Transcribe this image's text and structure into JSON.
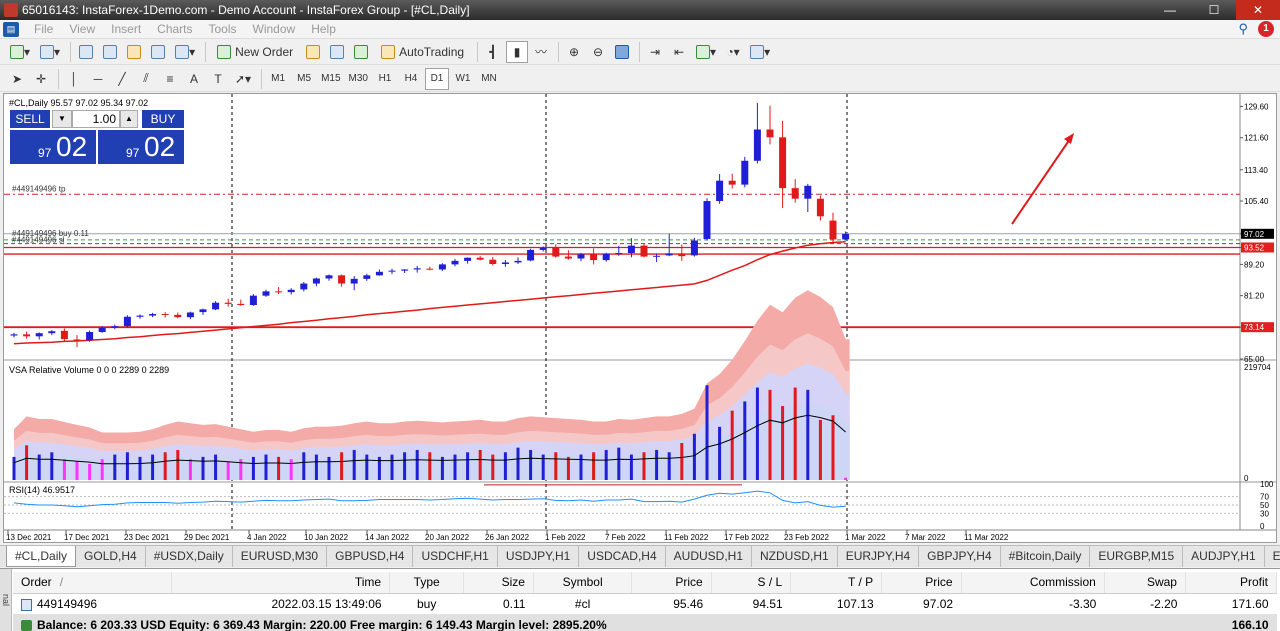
{
  "window": {
    "title": "65016143: InstaForex-1Demo.com - Demo Account - InstaForex Group - [#CL,Daily]",
    "min": "—",
    "max": "☐",
    "close": "✕"
  },
  "menu": {
    "items": [
      "File",
      "View",
      "Insert",
      "Charts",
      "Tools",
      "Window",
      "Help"
    ],
    "notification_count": "1"
  },
  "toolbar": {
    "new_order": "New Order",
    "autotrading": "AutoTrading",
    "timeframes": [
      "M1",
      "M5",
      "M15",
      "M30",
      "H1",
      "H4",
      "D1",
      "W1",
      "MN"
    ],
    "active_timeframe": "D1",
    "text_tool": "A"
  },
  "chart": {
    "header": "#CL,Daily  95.57 97.02 95.34 97.02",
    "vsa_label": "VSA Relative Volume 0 0 0 2289 0 2289",
    "rsi_label": "RSI(14) 46.9517",
    "order_labels": {
      "tp": "#449149496 tp",
      "buy": "#449149496 buy 0.11",
      "sl": "#449149496 sl"
    },
    "trade_panel": {
      "sell": "SELL",
      "buy": "BUY",
      "lot": "1.00",
      "sell_price_small": "97",
      "sell_price_big": "02",
      "buy_price_small": "97",
      "buy_price_big": "02"
    },
    "price_axis": [
      "129.60",
      "121.60",
      "113.40",
      "105.40",
      "97.02",
      "93.52",
      "89.20",
      "81.20",
      "73.14",
      "65.00"
    ],
    "price_badges": [
      {
        "text": "97.02",
        "color": "#000000"
      },
      {
        "text": "93.52",
        "color": "#e02020"
      },
      {
        "text": "73.14",
        "color": "#e02020"
      }
    ],
    "volume_axis": [
      "219704",
      "0"
    ],
    "rsi_axis": [
      "100",
      "70",
      "50",
      "30",
      "0"
    ],
    "date_axis": [
      "13 Dec 2021",
      "17 Dec 2021",
      "23 Dec 2021",
      "29 Dec 2021",
      "4 Jan 2022",
      "10 Jan 2022",
      "14 Jan 2022",
      "20 Jan 2022",
      "26 Jan 2022",
      "1 Feb 2022",
      "7 Feb 2022",
      "11 Feb 2022",
      "17 Feb 2022",
      "23 Feb 2022",
      "1 Mar 2022",
      "7 Mar 2022",
      "11 Mar 2022"
    ]
  },
  "chart_data": {
    "type": "candlestick",
    "symbol": "#CL",
    "timeframe": "Daily",
    "ylim": [
      65.0,
      131.5
    ],
    "candles": [
      [
        71.0,
        71.7,
        70.5,
        71.3
      ],
      [
        71.3,
        72.0,
        70.2,
        70.8
      ],
      [
        70.8,
        71.8,
        70.0,
        71.6
      ],
      [
        71.6,
        72.4,
        71.1,
        72.1
      ],
      [
        72.2,
        72.8,
        69.6,
        70.1
      ],
      [
        70.0,
        71.1,
        68.0,
        69.8
      ],
      [
        69.8,
        72.3,
        69.4,
        71.9
      ],
      [
        71.9,
        73.4,
        71.7,
        73.0
      ],
      [
        73.0,
        73.8,
        72.6,
        73.4
      ],
      [
        73.4,
        76.2,
        73.1,
        75.8
      ],
      [
        75.8,
        76.4,
        75.3,
        76.1
      ],
      [
        76.1,
        76.8,
        75.7,
        76.5
      ],
      [
        76.5,
        77.0,
        75.6,
        76.3
      ],
      [
        76.3,
        76.9,
        75.4,
        75.7
      ],
      [
        75.7,
        77.1,
        75.2,
        76.9
      ],
      [
        77.0,
        77.9,
        76.3,
        77.7
      ],
      [
        77.7,
        79.8,
        77.5,
        79.4
      ],
      [
        79.4,
        80.4,
        78.4,
        79.1
      ],
      [
        79.1,
        80.2,
        78.6,
        78.8
      ],
      [
        78.8,
        81.6,
        78.6,
        81.2
      ],
      [
        81.2,
        82.7,
        80.9,
        82.3
      ],
      [
        82.3,
        83.4,
        81.6,
        82.1
      ],
      [
        82.1,
        83.1,
        81.5,
        82.7
      ],
      [
        82.8,
        84.7,
        82.3,
        84.3
      ],
      [
        84.3,
        85.8,
        83.6,
        85.6
      ],
      [
        85.6,
        86.6,
        85.0,
        86.4
      ],
      [
        86.4,
        86.6,
        83.5,
        84.3
      ],
      [
        84.3,
        86.2,
        82.6,
        85.5
      ],
      [
        85.5,
        86.8,
        85.0,
        86.4
      ],
      [
        86.4,
        87.9,
        86.3,
        87.3
      ],
      [
        87.4,
        88.1,
        86.7,
        87.6
      ],
      [
        87.6,
        88.0,
        87.0,
        87.9
      ],
      [
        87.9,
        88.8,
        87.1,
        88.2
      ],
      [
        88.1,
        88.6,
        87.7,
        87.9
      ],
      [
        87.9,
        89.5,
        87.5,
        89.2
      ],
      [
        89.2,
        90.6,
        88.7,
        90.1
      ],
      [
        90.1,
        91.0,
        89.4,
        90.9
      ],
      [
        90.9,
        91.3,
        90.2,
        90.4
      ],
      [
        90.4,
        91.1,
        88.9,
        89.3
      ],
      [
        89.3,
        90.3,
        88.6,
        89.7
      ],
      [
        89.7,
        91.0,
        89.3,
        90.1
      ],
      [
        90.2,
        93.2,
        90.0,
        92.9
      ],
      [
        92.9,
        93.8,
        92.5,
        93.4
      ],
      [
        93.4,
        94.3,
        90.9,
        91.2
      ],
      [
        91.2,
        92.8,
        90.4,
        90.7
      ],
      [
        90.7,
        92.1,
        90.0,
        91.8
      ],
      [
        91.8,
        93.3,
        89.2,
        90.3
      ],
      [
        90.3,
        92.2,
        89.9,
        91.9
      ],
      [
        91.9,
        93.9,
        91.4,
        92.1
      ],
      [
        92.1,
        95.9,
        91.0,
        94.0
      ],
      [
        94.0,
        94.6,
        91.0,
        91.2
      ],
      [
        91.2,
        92.0,
        89.8,
        91.4
      ],
      [
        91.5,
        97.0,
        91.3,
        92.0
      ],
      [
        92.0,
        94.3,
        90.1,
        91.3
      ],
      [
        91.5,
        96.0,
        91.2,
        95.3
      ],
      [
        95.7,
        106.1,
        95.3,
        105.4
      ],
      [
        105.4,
        112.3,
        104.7,
        110.6
      ],
      [
        110.6,
        112.4,
        108.6,
        109.6
      ],
      [
        109.6,
        116.7,
        108.9,
        115.7
      ],
      [
        115.7,
        130.5,
        115.0,
        123.7
      ],
      [
        123.7,
        129.8,
        119.9,
        121.7
      ],
      [
        121.7,
        125.9,
        103.6,
        108.7
      ],
      [
        108.7,
        111.0,
        105.0,
        106.0
      ],
      [
        106.0,
        109.8,
        102.6,
        109.3
      ],
      [
        106.0,
        106.8,
        100.4,
        101.5
      ],
      [
        100.4,
        102.4,
        94.6,
        95.6
      ],
      [
        95.6,
        97.6,
        95.3,
        97.0
      ]
    ],
    "moving_average_red": [
      68.9,
      69.1,
      69.2,
      69.3,
      69.5,
      69.6,
      69.8,
      70.0,
      70.2,
      70.5,
      70.7,
      71.0,
      71.3,
      71.5,
      71.8,
      72.1,
      72.4,
      72.7,
      73.0,
      73.3,
      73.6,
      73.9,
      74.3,
      74.6,
      74.9,
      75.3,
      75.6,
      75.9,
      76.3,
      76.6,
      76.9,
      77.2,
      77.5,
      77.9,
      78.2,
      78.5,
      78.8,
      79.1,
      79.4,
      79.7,
      80.0,
      80.3,
      80.6,
      80.9,
      81.2,
      81.5,
      81.8,
      82.1,
      82.4,
      82.7,
      83.0,
      83.3,
      83.6,
      83.9,
      84.2,
      85.1,
      86.4,
      87.7,
      88.9,
      90.4,
      91.7,
      92.6,
      93.4,
      94.1,
      94.5,
      94.8,
      95.0
    ],
    "horizontal_levels": {
      "take_profit": 107.13,
      "entry_buy": 95.46,
      "stop_loss": 94.51,
      "current_price": 97.02,
      "support_1": 93.52,
      "support_2": 91.84,
      "support_3": 73.14
    },
    "volume": [
      1.0,
      1.5,
      1.1,
      1.2,
      0.9,
      0.8,
      0.7,
      0.9,
      1.1,
      1.2,
      1.0,
      1.1,
      1.2,
      1.3,
      0.9,
      1.0,
      1.1,
      0.8,
      0.9,
      1.0,
      1.1,
      1.0,
      0.9,
      1.2,
      1.1,
      1.0,
      1.2,
      1.3,
      1.1,
      1.0,
      1.1,
      1.2,
      1.3,
      1.2,
      1.0,
      1.1,
      1.2,
      1.3,
      1.1,
      1.2,
      1.4,
      1.3,
      1.1,
      1.2,
      1.0,
      1.1,
      1.2,
      1.3,
      1.4,
      1.1,
      1.2,
      1.3,
      1.2,
      1.6,
      2.0,
      4.1,
      2.3,
      3.0,
      3.4,
      4.0,
      3.9,
      3.2,
      4.0,
      3.9,
      2.6,
      2.8,
      0.1
    ],
    "rsi": [
      55,
      52,
      50,
      50,
      48,
      46,
      48,
      51,
      52,
      55,
      56,
      56,
      56,
      54,
      56,
      57,
      59,
      58,
      57,
      59,
      61,
      60,
      60,
      62,
      63,
      64,
      60,
      60,
      61,
      63,
      63,
      63,
      63,
      62,
      63,
      65,
      66,
      64,
      62,
      63,
      63,
      64,
      65,
      61,
      60,
      62,
      59,
      62,
      62,
      64,
      58,
      58,
      59,
      57,
      64,
      73,
      78,
      76,
      79,
      83,
      79,
      61,
      55,
      58,
      49,
      45,
      47
    ]
  },
  "tabs": [
    "#CL,Daily",
    "GOLD,H4",
    "#USDX,Daily",
    "EURUSD,M30",
    "GBPUSD,H4",
    "USDCHF,H1",
    "USDJPY,H1",
    "USDCAD,H4",
    "AUDUSD,H1",
    "NZDUSD,H1",
    "EURJPY,H4",
    "GBPJPY,H4",
    "#Bitcoin,Daily",
    "EURGBP,M15",
    "AUDJPY,H1",
    "EURAUD"
  ],
  "terminal": {
    "side_label": "nal",
    "headers": [
      "Order",
      "Time",
      "Type",
      "Size",
      "Symbol",
      "Price",
      "S / L",
      "T / P",
      "Price",
      "Commission",
      "Swap",
      "Profit"
    ],
    "rows": [
      [
        "449149496",
        "2022.03.15 13:49:06",
        "buy",
        "0.11",
        "#cl",
        "95.46",
        "94.51",
        "107.13",
        "97.02",
        "-3.30",
        "-2.20",
        "171.60"
      ]
    ],
    "balance_line": "Balance: 6 203.33 USD  Equity: 6 369.43  Margin: 220.00  Free margin: 6 149.43  Margin level: 2895.20%",
    "balance_profit": "166.10"
  }
}
